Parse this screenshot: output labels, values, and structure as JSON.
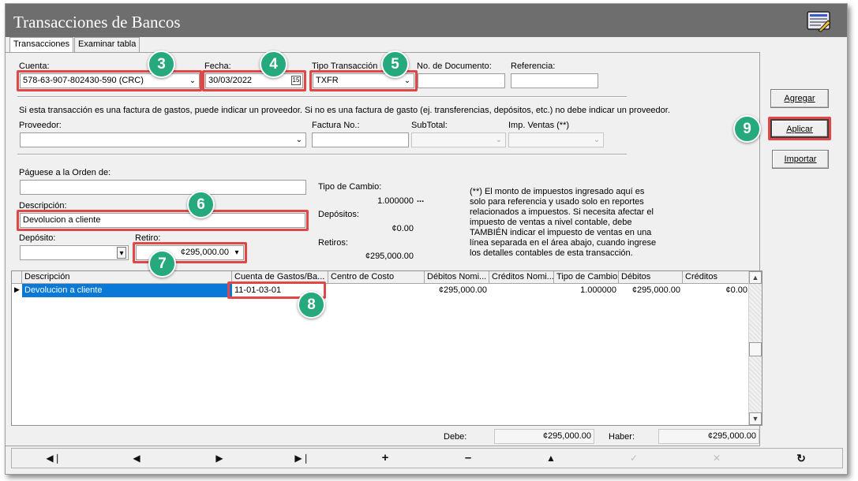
{
  "window": {
    "title": "Transacciones de Bancos",
    "icon": "calculator-list-icon"
  },
  "tabs": [
    {
      "label": "Transacciones"
    },
    {
      "label": "Examinar tabla"
    }
  ],
  "form": {
    "cuenta_label": "Cuenta:",
    "cuenta_value": "578-63-907-802430-590 (CRC)",
    "fecha_label": "Fecha:",
    "fecha_value": "30/03/2022",
    "tipo_label": "Tipo Transacción",
    "tipo_value": "TXFR",
    "nodoc_label": "No. de Documento:",
    "nodoc_value": "",
    "referencia_label": "Referencia:",
    "referencia_value": "",
    "info_text": "Si esta transacción es una factura de gastos, puede indicar un proveedor. Si no es una factura de gasto (ej. transferencias, depósitos, etc.) no debe indicar un proveedor.",
    "proveedor_label": "Proveedor:",
    "proveedor_value": "",
    "factura_label": "Factura No.:",
    "subtotal_label": "SubTotal:",
    "impventas_label": "Imp. Ventas (**)",
    "paguese_label": "Páguese a la Orden de:",
    "paguese_value": "",
    "descripcion_label": "Descripción:",
    "descripcion_value": "Devolucion a cliente",
    "deposito_label": "Depósito:",
    "deposito_value": "",
    "retiro_label": "Retiro:",
    "retiro_value": "¢295,000.00",
    "tipocambio_label": "Tipo de Cambio:",
    "tipocambio_value": "1.000000",
    "tipocambio_more": "...",
    "depositos_label": "Depósitos:",
    "depositos_value": "¢0.00",
    "retiros_label": "Retiros:",
    "retiros_value": "¢295,000.00",
    "note": "(**) El monto de impuestos ingresado aquí es solo para referencia y usado solo en reportes relacionados a impuestos. Si necesita afectar el impuesto de ventas a nivel contable, debe TAMBIÉN indicar el impuesto de ventas en una línea separada en el área abajo, cuando ingrese los detalles contables de esta transacción."
  },
  "buttons": {
    "agregar": "Agregar",
    "aplicar": "Aplicar",
    "importar": "Importar"
  },
  "badges": [
    "3",
    "4",
    "5",
    "6",
    "7",
    "8",
    "9"
  ],
  "grid": {
    "columns": [
      "Descripción",
      "Cuenta de Gastos/Ba...",
      "Centro de Costo",
      "Débitos Nomi...",
      "Créditos Nomi...",
      "Tipo de Cambio",
      "Débitos",
      "Créditos"
    ],
    "rows": [
      {
        "descripcion": "Devolucion a cliente",
        "cuenta": "11-01-03-01",
        "centro": "",
        "debitos_nom": "¢295,000.00",
        "creditos_nom": "",
        "tipo_cambio": "1.000000",
        "debitos": "¢295,000.00",
        "creditos": "¢0.00"
      }
    ]
  },
  "totals": {
    "debe_label": "Debe:",
    "debe_value": "¢295,000.00",
    "haber_label": "Haber:",
    "haber_value": "¢295,000.00"
  },
  "navbar": [
    "first-record-icon",
    "prev-record-icon",
    "next-record-icon",
    "last-record-icon",
    "plus-icon",
    "minus-icon",
    "up-triangle-icon",
    "check-icon",
    "cancel-icon",
    "refresh-icon"
  ],
  "colors": {
    "title_bar": "#6e6e6e",
    "highlight": "#e04848",
    "badge": "#26a97c",
    "selection": "#0a78d7"
  }
}
